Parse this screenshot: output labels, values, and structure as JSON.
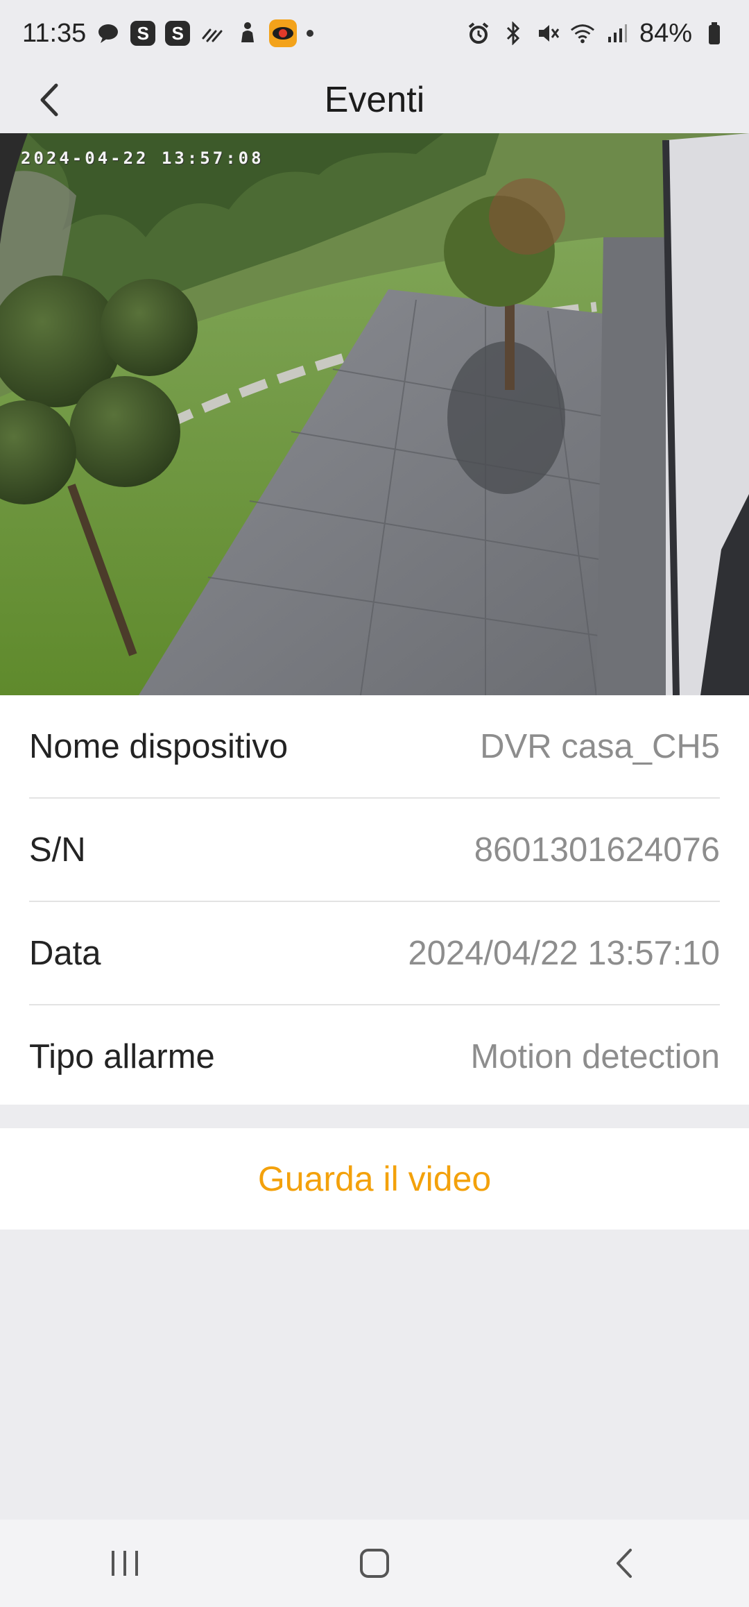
{
  "status_bar": {
    "time": "11:35",
    "battery": "84%",
    "left_icons": [
      "chat-bubble-icon",
      "s-app-icon",
      "s-app-icon",
      "weather-icon",
      "fitness-icon",
      "camera-app-icon",
      "more-dot-icon"
    ],
    "right_icons": [
      "alarm-icon",
      "bluetooth-icon",
      "mute-icon",
      "wifi-icon",
      "signal-icon",
      "battery-icon"
    ],
    "s_badge": "S"
  },
  "appbar": {
    "title": "Eventi"
  },
  "snapshot": {
    "timestamp": "2024-04-22 13:57:08"
  },
  "details": [
    {
      "label": "Nome dispositivo",
      "value": "DVR casa_CH5"
    },
    {
      "label": "S/N",
      "value": "8601301624076"
    },
    {
      "label": "Data",
      "value": "2024/04/22 13:57:10"
    },
    {
      "label": "Tipo allarme",
      "value": "Motion detection"
    }
  ],
  "action": {
    "label": "Guarda il video",
    "color": "#f3a10b"
  },
  "nav_bar": {
    "icons": [
      "recent-apps-icon",
      "home-icon",
      "back-icon"
    ]
  }
}
